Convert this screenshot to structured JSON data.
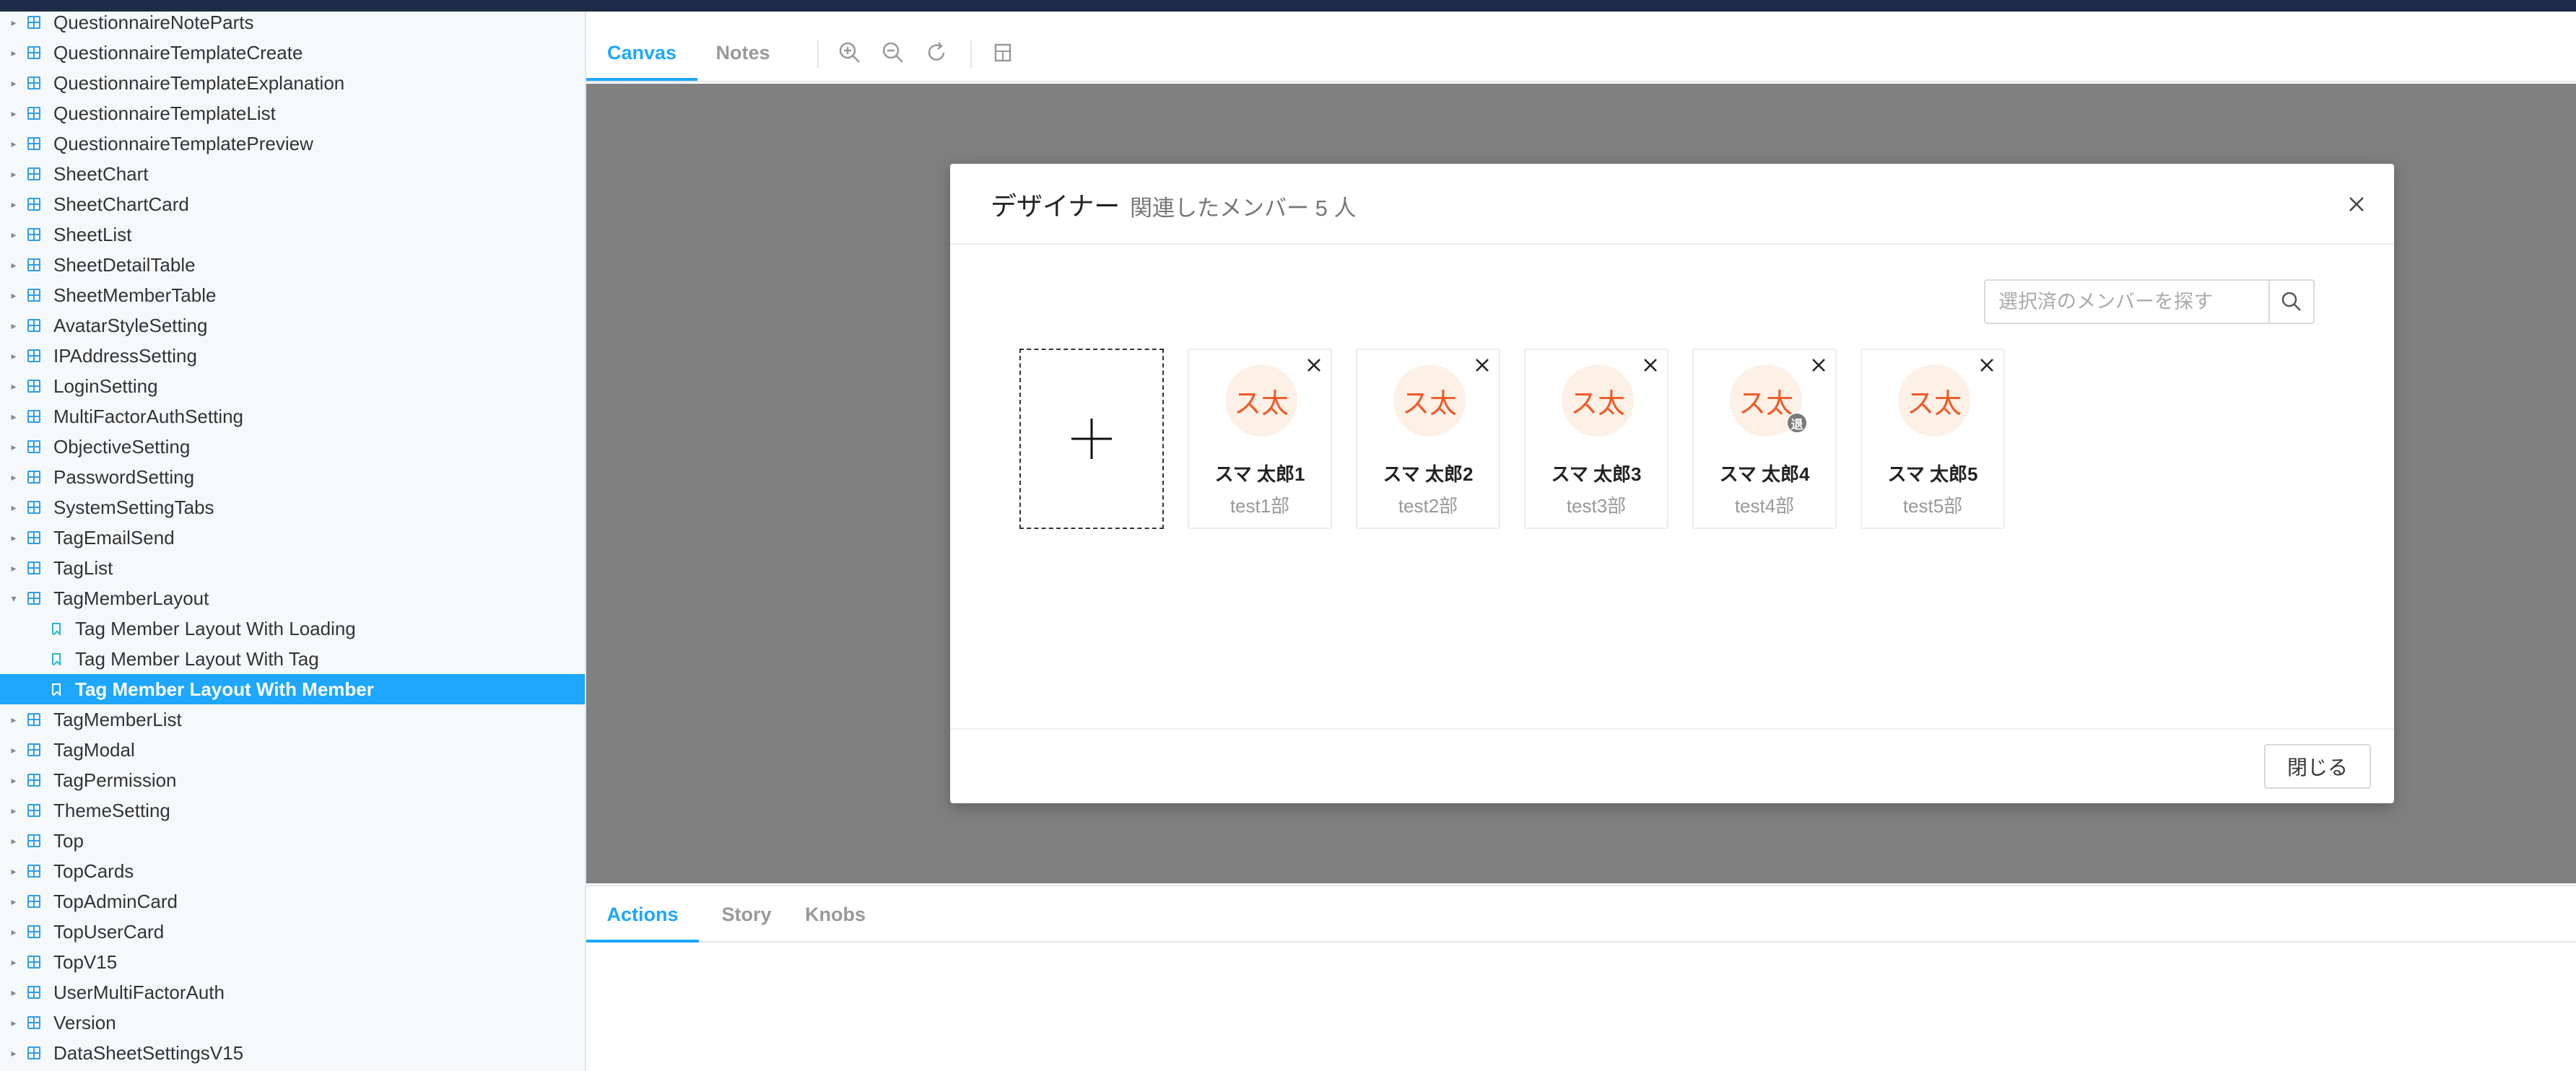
{
  "sidebar": {
    "items": [
      {
        "label": "QuestionnaireNoteParts",
        "kind": "component",
        "expanded": false
      },
      {
        "label": "QuestionnaireTemplateCreate",
        "kind": "component",
        "expanded": false
      },
      {
        "label": "QuestionnaireTemplateExplanation",
        "kind": "component",
        "expanded": false
      },
      {
        "label": "QuestionnaireTemplateList",
        "kind": "component",
        "expanded": false
      },
      {
        "label": "QuestionnaireTemplatePreview",
        "kind": "component",
        "expanded": false
      },
      {
        "label": "SheetChart",
        "kind": "component",
        "expanded": false
      },
      {
        "label": "SheetChartCard",
        "kind": "component",
        "expanded": false
      },
      {
        "label": "SheetList",
        "kind": "component",
        "expanded": false
      },
      {
        "label": "SheetDetailTable",
        "kind": "component",
        "expanded": false
      },
      {
        "label": "SheetMemberTable",
        "kind": "component",
        "expanded": false
      },
      {
        "label": "AvatarStyleSetting",
        "kind": "component",
        "expanded": false
      },
      {
        "label": "IPAddressSetting",
        "kind": "component",
        "expanded": false
      },
      {
        "label": "LoginSetting",
        "kind": "component",
        "expanded": false
      },
      {
        "label": "MultiFactorAuthSetting",
        "kind": "component",
        "expanded": false
      },
      {
        "label": "ObjectiveSetting",
        "kind": "component",
        "expanded": false
      },
      {
        "label": "PasswordSetting",
        "kind": "component",
        "expanded": false
      },
      {
        "label": "SystemSettingTabs",
        "kind": "component",
        "expanded": false
      },
      {
        "label": "TagEmailSend",
        "kind": "component",
        "expanded": false
      },
      {
        "label": "TagList",
        "kind": "component",
        "expanded": false
      },
      {
        "label": "TagMemberLayout",
        "kind": "component",
        "expanded": true
      },
      {
        "label": "Tag Member Layout With Loading",
        "kind": "story"
      },
      {
        "label": "Tag Member Layout With Tag",
        "kind": "story"
      },
      {
        "label": "Tag Member Layout With Member",
        "kind": "story",
        "selected": true
      },
      {
        "label": "TagMemberList",
        "kind": "component",
        "expanded": false
      },
      {
        "label": "TagModal",
        "kind": "component",
        "expanded": false
      },
      {
        "label": "TagPermission",
        "kind": "component",
        "expanded": false
      },
      {
        "label": "ThemeSetting",
        "kind": "component",
        "expanded": false
      },
      {
        "label": "Top",
        "kind": "component",
        "expanded": false
      },
      {
        "label": "TopCards",
        "kind": "component",
        "expanded": false
      },
      {
        "label": "TopAdminCard",
        "kind": "component",
        "expanded": false
      },
      {
        "label": "TopUserCard",
        "kind": "component",
        "expanded": false
      },
      {
        "label": "TopV15",
        "kind": "component",
        "expanded": false
      },
      {
        "label": "UserMultiFactorAuth",
        "kind": "component",
        "expanded": false
      },
      {
        "label": "Version",
        "kind": "component",
        "expanded": false
      },
      {
        "label": "DataSheetSettingsV15",
        "kind": "component",
        "expanded": false
      }
    ]
  },
  "toolbar": {
    "tabs": [
      {
        "label": "Canvas",
        "active": true
      },
      {
        "label": "Notes",
        "active": false
      }
    ],
    "icons": [
      "zoom-in-icon",
      "zoom-out-icon",
      "reset-zoom-icon",
      "grid-background-icon"
    ]
  },
  "modal": {
    "title": "デザイナー",
    "subtitle": "関連したメンバー  5  人",
    "search_placeholder": "選択済のメンバーを探す",
    "add_icon": "plus-icon",
    "members": [
      {
        "avatar_text": "ス太",
        "name": "スマ 太郎1",
        "dept": "test1部",
        "badge": ""
      },
      {
        "avatar_text": "ス太",
        "name": "スマ 太郎2",
        "dept": "test2部",
        "badge": ""
      },
      {
        "avatar_text": "ス太",
        "name": "スマ 太郎3",
        "dept": "test3部",
        "badge": ""
      },
      {
        "avatar_text": "ス太",
        "name": "スマ 太郎4",
        "dept": "test4部",
        "badge": "退"
      },
      {
        "avatar_text": "ス太",
        "name": "スマ 太郎5",
        "dept": "test5部",
        "badge": ""
      }
    ],
    "close_label": "閉じる"
  },
  "panel": {
    "tabs": [
      {
        "label": "Actions",
        "active": true
      },
      {
        "label": "Story",
        "active": false
      },
      {
        "label": "Knobs",
        "active": false
      }
    ]
  },
  "colors": {
    "accent": "#1ea7fd",
    "canvas_bg": "#808080",
    "avatar_bg": "#fdf0e6",
    "avatar_text": "#f05a28",
    "topbar": "#1d2b46"
  }
}
